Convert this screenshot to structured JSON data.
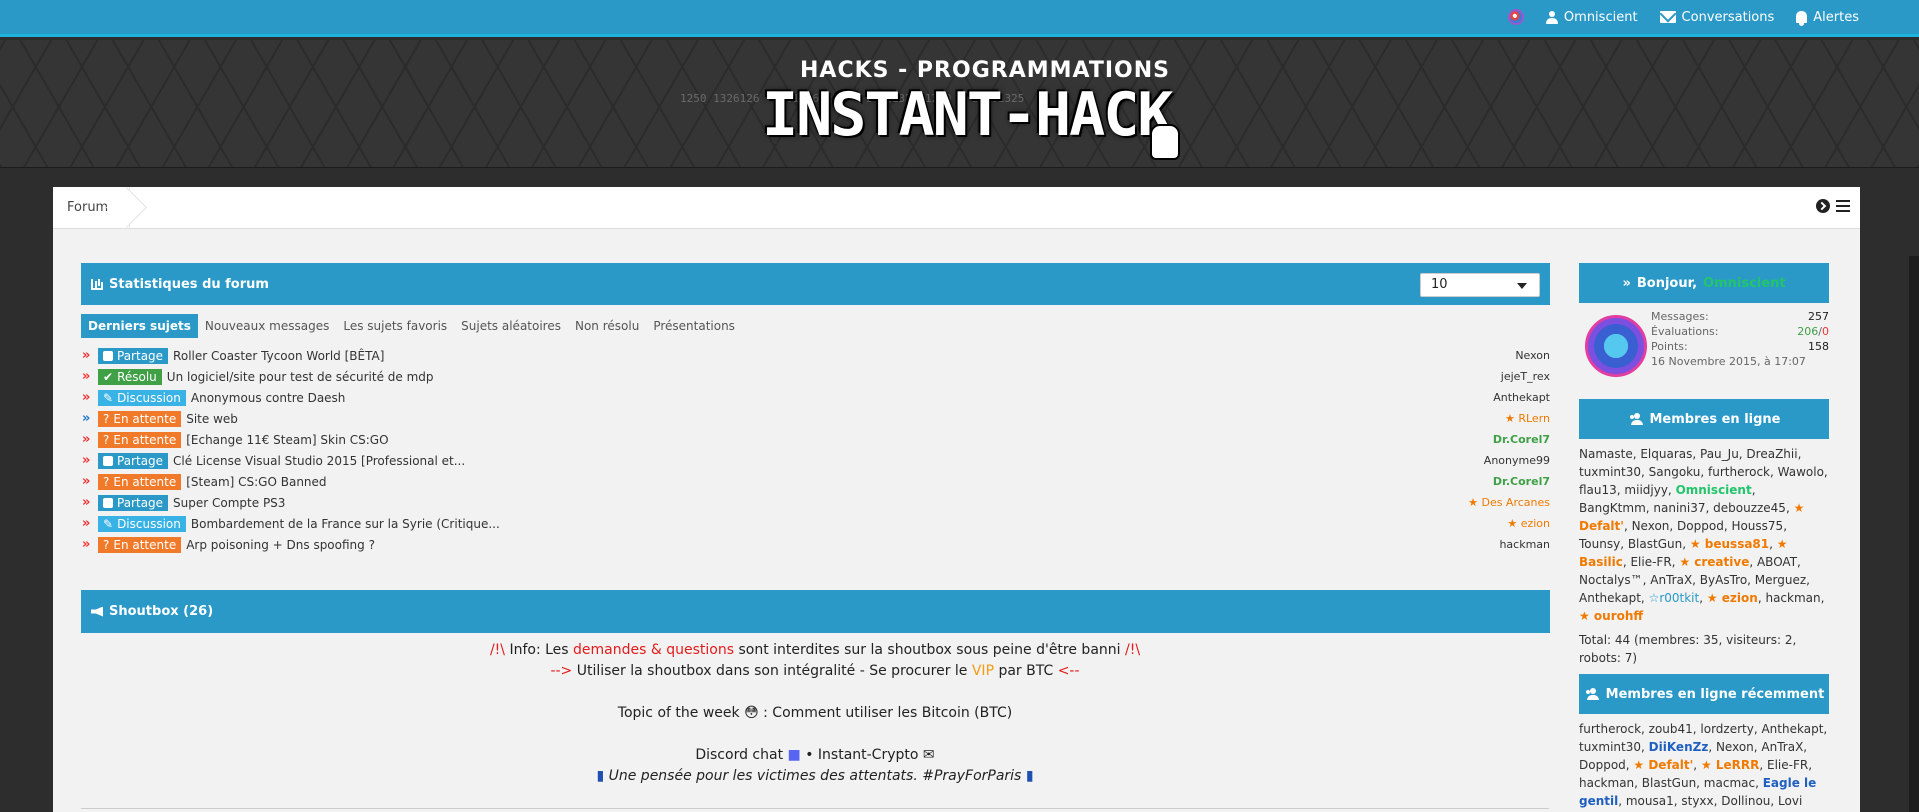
{
  "topnav": {
    "user": "Omniscient",
    "conversations": "Conversations",
    "alerts": "Alertes"
  },
  "banner": {
    "tagline": "HACKS - PROGRAMMATIONS",
    "title": "INSTANT-HACK"
  },
  "breadcrumb": {
    "forums": "Forums"
  },
  "stats_panel": {
    "title": "Statistiques du forum",
    "select_value": "10",
    "tabs": [
      "Derniers sujets",
      "Nouveaux messages",
      "Les sujets favoris",
      "Sujets aléatoires",
      "Non résolu",
      "Présentations"
    ],
    "topics": [
      {
        "label": "Partage",
        "title": "Roller Coaster Tycoon World [BÊTA]",
        "author": "Nexon"
      },
      {
        "label": "Résolu",
        "title": "Un logiciel/site pour test de sécurité de mdp",
        "author": "jejeT_rex"
      },
      {
        "label": "Discussion",
        "title": "Anonymous contre Daesh",
        "author": "Anthekapt"
      },
      {
        "label": "En attente",
        "title": "Site web",
        "author": "RLern"
      },
      {
        "label": "En attente",
        "title": "[Echange 11€ Steam] Skin CS:GO",
        "author": "Dr.Corel7"
      },
      {
        "label": "Partage",
        "title": "Clé License Visual Studio 2015 [Professional et...",
        "author": "Anonyme99"
      },
      {
        "label": "En attente",
        "title": "[Steam] CS:GO Banned",
        "author": "Dr.Corel7"
      },
      {
        "label": "Partage",
        "title": "Super Compte PS3",
        "author": "Des Arcanes"
      },
      {
        "label": "Discussion",
        "title": "Bombardement de la France sur la Syrie (Critique...",
        "author": "ezion"
      },
      {
        "label": "En attente",
        "title": "Arp poisoning + Dns spoofing ?",
        "author": "hackman"
      }
    ]
  },
  "shoutbox": {
    "title": "Shoutbox (26)",
    "line1_a": "/!\\ ",
    "line1_b": "Info: Les ",
    "line1_c": "demandes & questions",
    "line1_d": " sont interdites sur la shoutbox sous peine d'être banni ",
    "line1_e": "/!\\",
    "line2_a": "--> ",
    "line2_b": "Utiliser la shoutbox dans son intégralité - Se procurer le ",
    "line2_c": "VIP",
    "line2_d": " par BTC ",
    "line2_e": "<--",
    "topic_a": "Topic of the week ",
    "topic_b": " : Comment utiliser les Bitcoin (BTC)",
    "discord_a": "Discord chat ",
    "discord_b": " • Instant-Crypto ",
    "pray": "Une pensée pour les victimes des attentats. #PrayForParis"
  },
  "welcome": {
    "greeting": "Bonjour, ",
    "name": "Omniscient",
    "messages_label": "Messages:",
    "messages_value": "257",
    "eval_label": "Évaluations:",
    "eval_pos": "206",
    "eval_sep": "/",
    "eval_neg": "0",
    "points_label": "Points:",
    "points_value": "158",
    "date": "16 Novembre 2015, à 17:07"
  },
  "online": {
    "title": "Membres en ligne",
    "total": "Total: 44 (membres: 35, visiteurs: 2, robots: 7)"
  },
  "recent": {
    "title": "Membres en ligne récemment"
  },
  "colors": {
    "accent": "#2a99c8",
    "resolu": "#3fa046",
    "attente": "#f07a2a",
    "discussion": "#39b2e6"
  }
}
